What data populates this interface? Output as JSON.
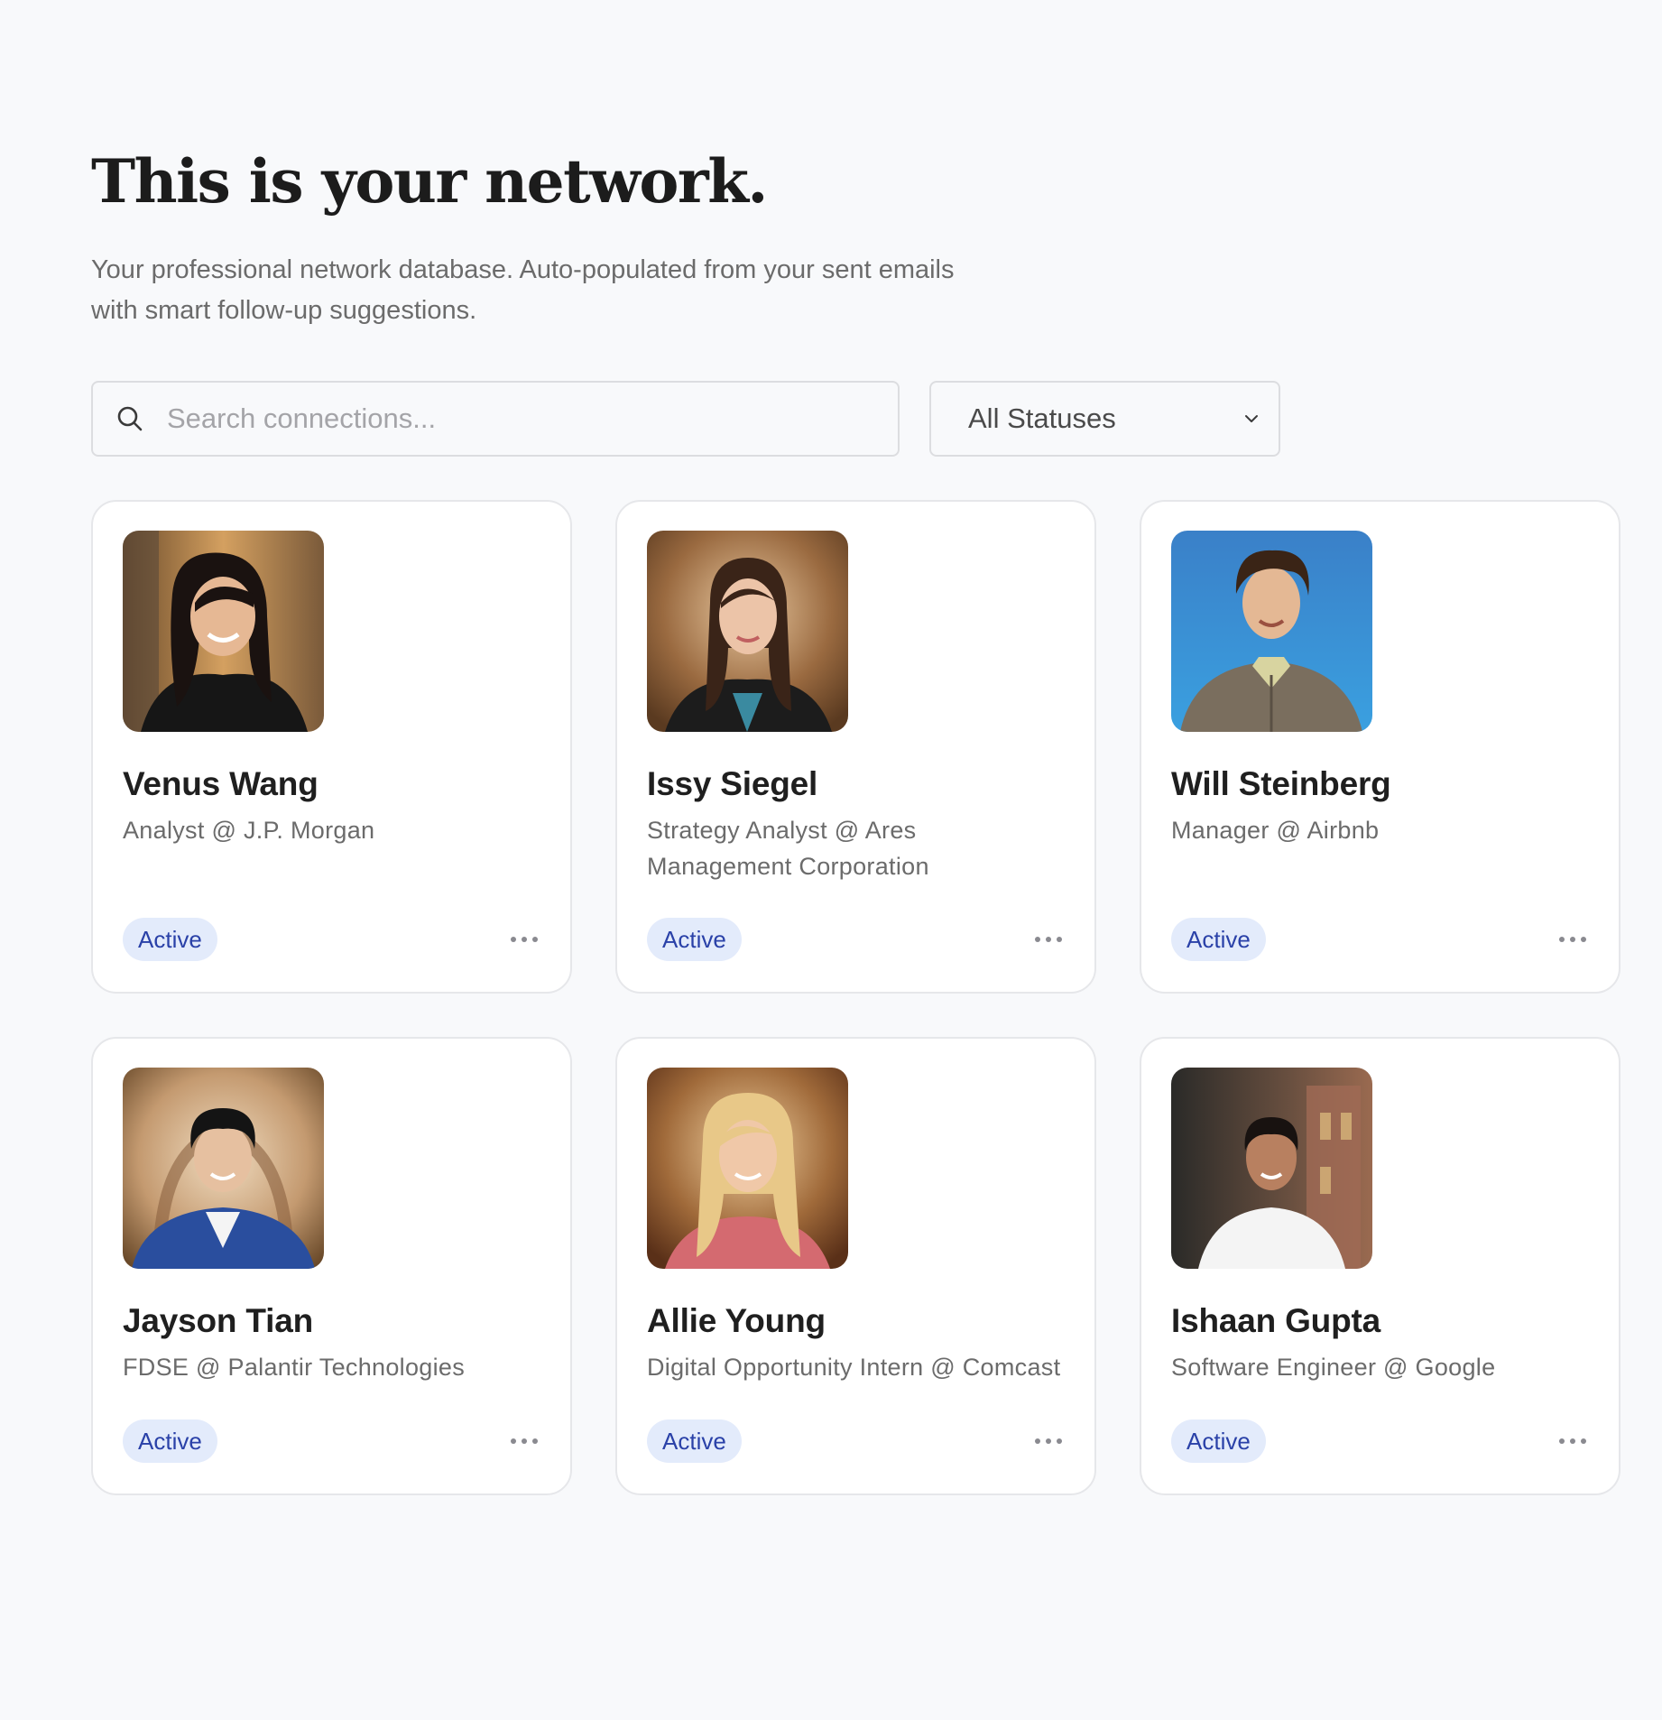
{
  "header": {
    "title": "This is your network.",
    "subtitle": "Your professional network database. Auto-populated from your sent emails with smart follow-up suggestions."
  },
  "search": {
    "placeholder": "Search connections...",
    "value": ""
  },
  "filter": {
    "selected": "All Statuses"
  },
  "colors": {
    "background": "#f8f9fb",
    "badge_bg": "#e3ebfb",
    "badge_text": "#2a41a8"
  },
  "connections": [
    {
      "name": "Venus Wang",
      "role": "Analyst @ J.P. Morgan",
      "status": "Active"
    },
    {
      "name": "Issy Siegel",
      "role": "Strategy Analyst @ Ares Management Corporation",
      "status": "Active"
    },
    {
      "name": "Will Steinberg",
      "role": "Manager @ Airbnb",
      "status": "Active"
    },
    {
      "name": "Jayson Tian",
      "role": "FDSE @ Palantir Technologies",
      "status": "Active"
    },
    {
      "name": "Allie Young",
      "role": "Digital Opportunity Intern @ Comcast",
      "status": "Active"
    },
    {
      "name": "Ishaan Gupta",
      "role": "Software Engineer @ Google",
      "status": "Active"
    }
  ]
}
